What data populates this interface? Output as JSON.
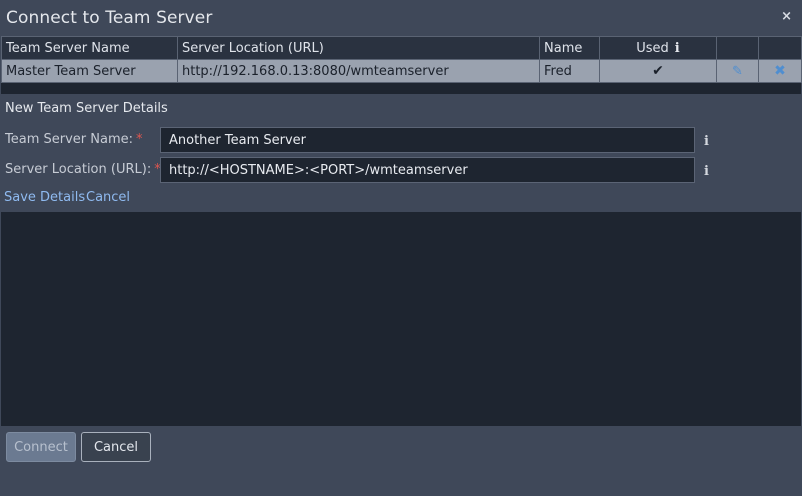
{
  "dialog": {
    "title": "Connect to Team Server",
    "close_glyph": "×"
  },
  "table": {
    "columns": [
      "Team Server Name",
      "Server Location (URL)",
      "Name",
      "Used",
      "",
      ""
    ],
    "used_info_glyph": "i",
    "rows": [
      {
        "name": "Master Team Server",
        "url": "http://192.168.0.13:8080/wmteamserver",
        "user": "Fred",
        "used_glyph": "✔",
        "edit_glyph": "✎",
        "delete_glyph": "✖"
      }
    ]
  },
  "details": {
    "heading": "New Team Server Details",
    "name_label": "Team Server Name:",
    "name_value": "Another Team Server",
    "url_label": "Server Location (URL):",
    "url_value": "http://<HOSTNAME>:<PORT>/wmteamserver",
    "required_mark": "*",
    "info_glyph": "i",
    "save_link": "Save Details",
    "cancel_link": "Cancel"
  },
  "footer": {
    "connect_label": "Connect",
    "cancel_label": "Cancel"
  },
  "icons": {
    "close": "close-icon",
    "info": "info-icon",
    "check": "check-icon",
    "edit": "pencil-icon",
    "delete": "delete-icon"
  },
  "colors": {
    "accent_link": "#8fbaf0",
    "selected_row": "#9aa2af",
    "required": "#e0564f",
    "action_icon": "#4f8ed0"
  }
}
